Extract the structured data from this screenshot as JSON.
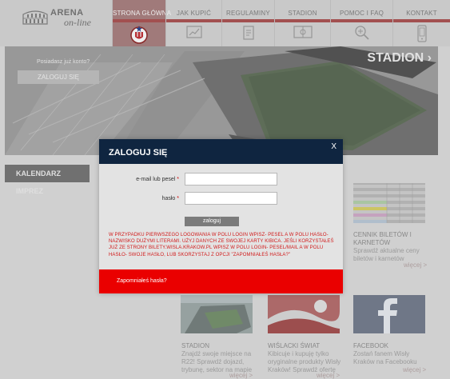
{
  "logo": {
    "line1": "ARENA",
    "line2": "on-line"
  },
  "nav": [
    {
      "label": "STRONA GŁÓWNA",
      "icon": "club-crest-icon"
    },
    {
      "label": "JAK KUPIĆ",
      "icon": "ticket-icon"
    },
    {
      "label": "REGULAMINY",
      "icon": "document-icon"
    },
    {
      "label": "STADION",
      "icon": "pitch-icon"
    },
    {
      "label": "POMOC I FAQ",
      "icon": "magnifier-icon"
    },
    {
      "label": "KONTAKT",
      "icon": "phone-icon"
    }
  ],
  "hero": {
    "login_question": "Posiadasz już konto?",
    "login_button": "ZALOGUJ SIĘ",
    "title": "STADION ›"
  },
  "calendar": {
    "label": "KALENDARZ IMPREZ"
  },
  "tiles": [
    {
      "title": "CENNIK BILETÓW I KARNETÓW",
      "desc": "Sprawdź aktualne ceny biletów i karnetów",
      "more": "więcej >"
    },
    {
      "title": "STADION",
      "desc": "Znajdź swoje miejsce na R22! Sprawdź dojazd, trybunę, sektor na mapie",
      "more": "więcej >"
    },
    {
      "title": "WIŚLACKI ŚWIAT",
      "desc": "Kibicuje i kupuję tylko oryginalne produkty Wisły Kraków! Sprawdź ofertę",
      "more": "więcej >"
    },
    {
      "title": "FACEBOOK",
      "desc": "Zostań fanem Wisły Kraków na Facebooku",
      "more": "więcej >"
    }
  ],
  "modal": {
    "title": "ZALOGUJ SIĘ",
    "close": "X",
    "email_label": "e-mail lub pesel",
    "password_label": "hasło",
    "required_mark": "*",
    "submit_label": "zaloguj",
    "info": "W PRZYPADKU PIERWSZEGO LOGOWANIA W POLU LOGIN WPISZ- PESEL A W POLU HASŁO- NAZWISKO DUŻYMI LITERAMI. UŻYJ DANYCH ZE SWOJEJ KARTY KIBICA. JEŚLI KORZYSTAŁEŚ JUŻ ZE STRONY BILETY.WISLA.KRAKOW.PL WPISZ W POLU LOGIN- PESEL/MAIL A W POLU HASŁO- SWOJE HASŁO, LUB SKORZYSTAJ Z OPCJI \"ZAPOMNIAŁEŚ HASŁA?\"",
    "forgot_link": "Zapomniałeś hasła?"
  },
  "colors": {
    "modal_header": "#0f2540",
    "forgot_bar": "#ea0000",
    "nav_accent": "#a84a4a",
    "info_text": "#d11a1a"
  }
}
